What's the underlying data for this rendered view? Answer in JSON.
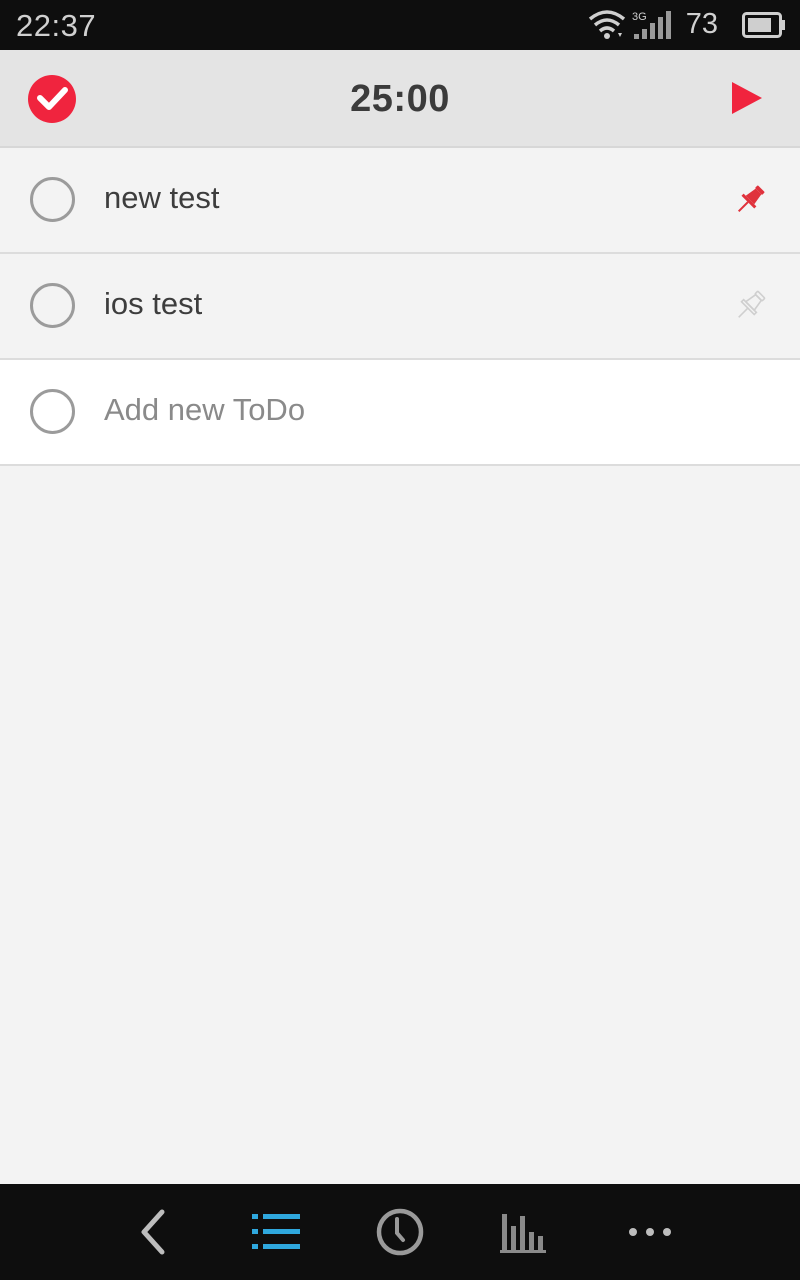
{
  "status_bar": {
    "time": "22:37",
    "battery_level": "73",
    "network_type": "3G",
    "icons": [
      "wifi-icon",
      "signal-icon",
      "battery-icon"
    ]
  },
  "header": {
    "timer": "25:00",
    "logo_icon": "check-circle-logo",
    "play_icon": "play-icon"
  },
  "todos": [
    {
      "label": "new test",
      "pinned": true
    },
    {
      "label": "ios test",
      "pinned": false
    }
  ],
  "add_new": {
    "placeholder": "Add new ToDo"
  },
  "bottom_nav": {
    "items": [
      "back-icon",
      "list-icon",
      "clock-icon",
      "stats-icon",
      "more-icon"
    ],
    "active": "list-icon"
  },
  "colors": {
    "accent": "#f0243e",
    "active_nav": "#2fa8de",
    "pin_active": "#e0323c",
    "pin_inactive": "#cfcfcf"
  }
}
